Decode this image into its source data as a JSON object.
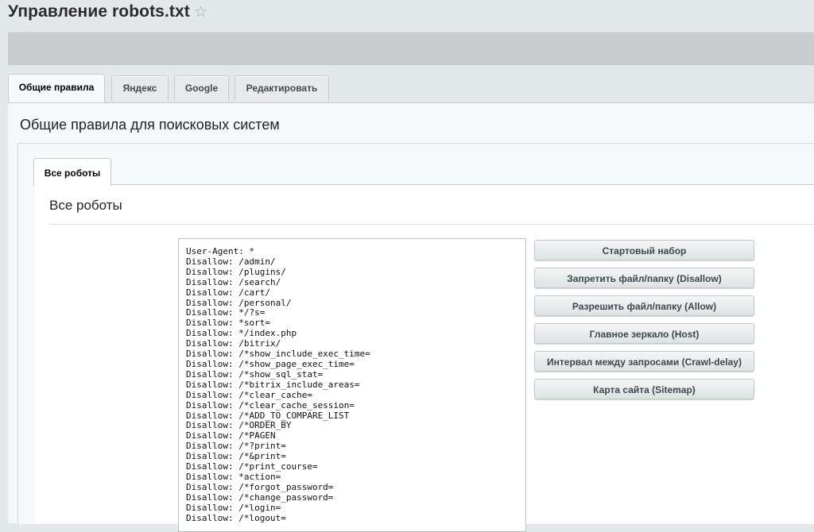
{
  "page": {
    "title": "Управление robots.txt"
  },
  "tabs": [
    {
      "label": "Общие правила",
      "active": true
    },
    {
      "label": "Яндекс"
    },
    {
      "label": "Google"
    },
    {
      "label": "Редактировать"
    }
  ],
  "panel": {
    "title": "Общие правила для поисковых систем"
  },
  "inner": {
    "tab_label": "Все роботы",
    "section_title": "Все роботы"
  },
  "editor": {
    "lines": [
      "User-Agent: *",
      "Disallow: /admin/",
      "Disallow: /plugins/",
      "Disallow: /search/",
      "Disallow: /cart/",
      "Disallow: /personal/",
      "Disallow: */?s=",
      "Disallow: *sort=",
      "Disallow: */index.php",
      "Disallow: /bitrix/",
      "Disallow: /*show_include_exec_time=",
      "Disallow: /*show_page_exec_time=",
      "Disallow: /*show_sql_stat=",
      "Disallow: /*bitrix_include_areas=",
      "Disallow: /*clear_cache=",
      "Disallow: /*clear_cache_session=",
      "Disallow: /*ADD_TO_COMPARE_LIST",
      "Disallow: /*ORDER_BY",
      "Disallow: /*PAGEN",
      "Disallow: /*?print=",
      "Disallow: /*&print=",
      "Disallow: /*print_course=",
      "Disallow: *action=",
      "Disallow: /*forgot_password=",
      "Disallow: /*change_password=",
      "Disallow: /*login=",
      "Disallow: /*logout="
    ]
  },
  "buttons": [
    {
      "label": "Стартовый набор"
    },
    {
      "label": "Запретить файл/папку (Disallow)"
    },
    {
      "label": "Разрешить файл/папку (Allow)"
    },
    {
      "label": "Главное зеркало (Host)"
    },
    {
      "label": "Интервал между запросами (Crawl-delay)"
    },
    {
      "label": "Карта сайта (Sitemap)"
    }
  ]
}
